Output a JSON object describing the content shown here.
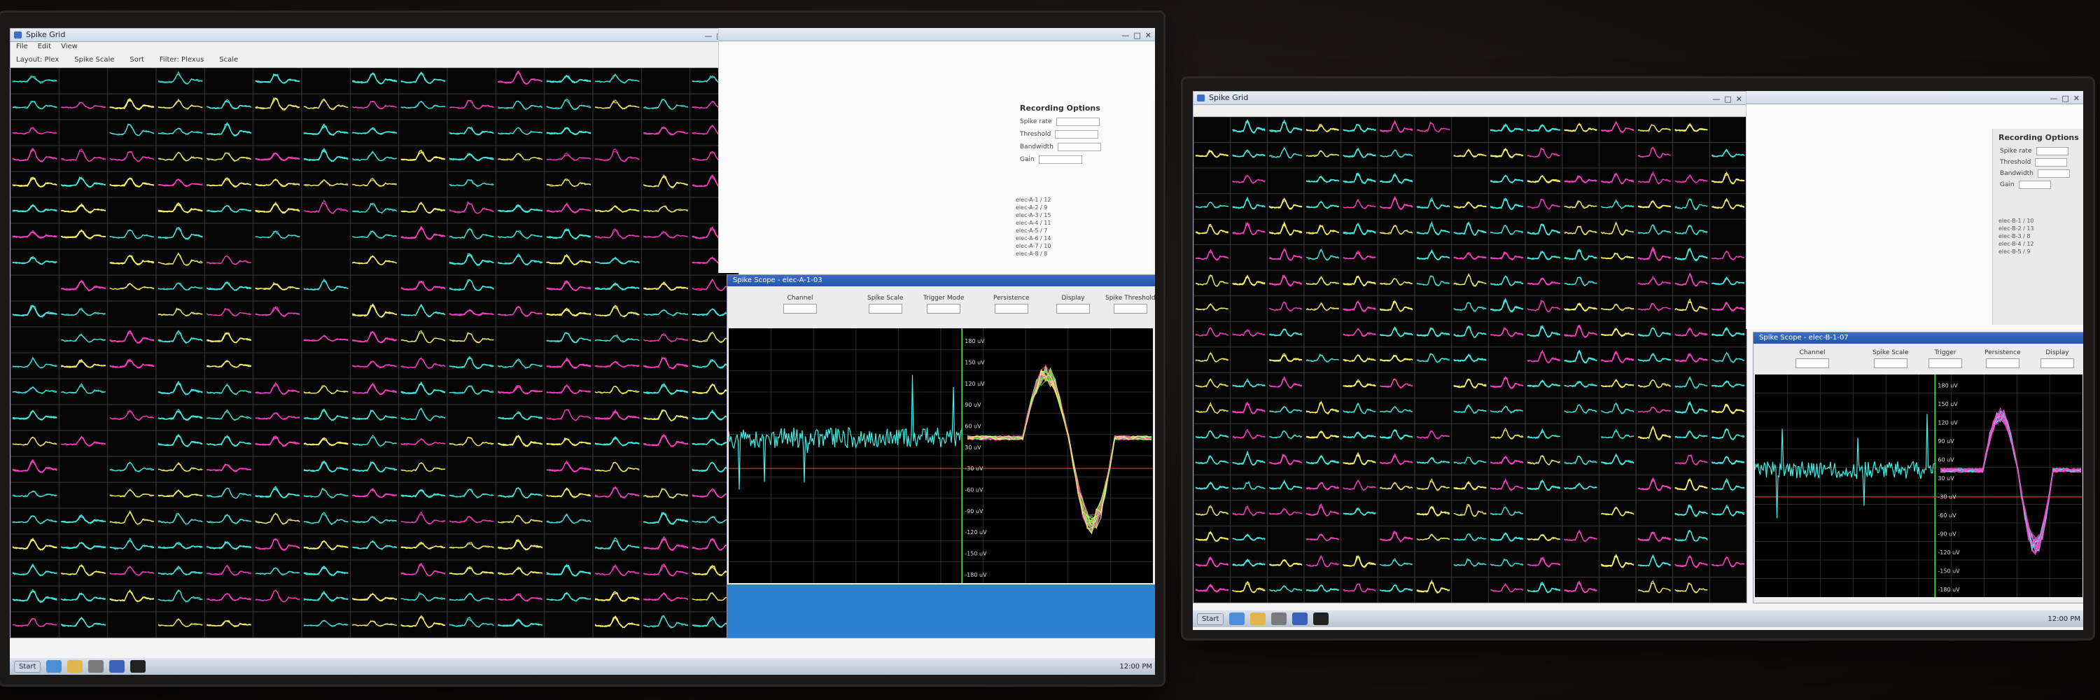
{
  "left_monitor": {
    "grid_window_title": "Spike Grid",
    "menu": [
      "File",
      "Edit",
      "View"
    ],
    "toolbar": [
      "Layout: Plex",
      "Spike Scale",
      "Sort",
      "Filter: Plexus",
      "Scale"
    ],
    "settings_title": "Recording Options",
    "settings_fields": [
      "Spike rate",
      "Threshold",
      "Bandwidth",
      "Gain"
    ],
    "settings_list": [
      "elec-A-1 / 12",
      "elec-A-2 / 9",
      "elec-A-3 / 15",
      "elec-A-4 / 11",
      "elec-A-5 / 7",
      "elec-A-6 / 14",
      "elec-A-7 / 10",
      "elec-A-8 / 8"
    ],
    "scope_title": "Spike Scope - elec-A-1-03",
    "scope_controls": [
      "Channel",
      "Spike Scale",
      "Trigger Mode",
      "Persistence",
      "Display",
      "Spike Threshold"
    ],
    "scope_y_labels": [
      "180 uV",
      "150 uV",
      "120 uV",
      "90 uV",
      "60 uV",
      "30 uV",
      "-30 uV",
      "-60 uV",
      "-90 uV",
      "-120 uV",
      "-150 uV",
      "-180 uV"
    ],
    "start_label": "Start",
    "clock": "12:00 PM"
  },
  "right_monitor": {
    "grid_window_title": "Spike Grid",
    "settings_title": "Recording Options",
    "settings_fields": [
      "Spike rate",
      "Threshold",
      "Bandwidth",
      "Gain"
    ],
    "settings_list": [
      "elec-B-1 / 10",
      "elec-B-2 / 13",
      "elec-B-3 / 8",
      "elec-B-4 / 12",
      "elec-B-5 / 9"
    ],
    "scope_title": "Spike Scope - elec-B-1-07",
    "scope_controls": [
      "Channel",
      "Spike Scale",
      "Trigger",
      "Persistence",
      "Display"
    ],
    "scope_y_labels": [
      "180 uV",
      "150 uV",
      "120 uV",
      "90 uV",
      "60 uV",
      "30 uV",
      "-30 uV",
      "-60 uV",
      "-90 uV",
      "-120 uV",
      "-150 uV",
      "-180 uV"
    ],
    "start_label": "Start",
    "clock": "12:00 PM"
  },
  "colors": {
    "cyan": "#43f0e6",
    "magenta": "#ff3fc8",
    "yellow": "#fff86a",
    "green": "#4bff4b",
    "grid_line": "#3a3a3a",
    "threshold": "#e33030"
  }
}
